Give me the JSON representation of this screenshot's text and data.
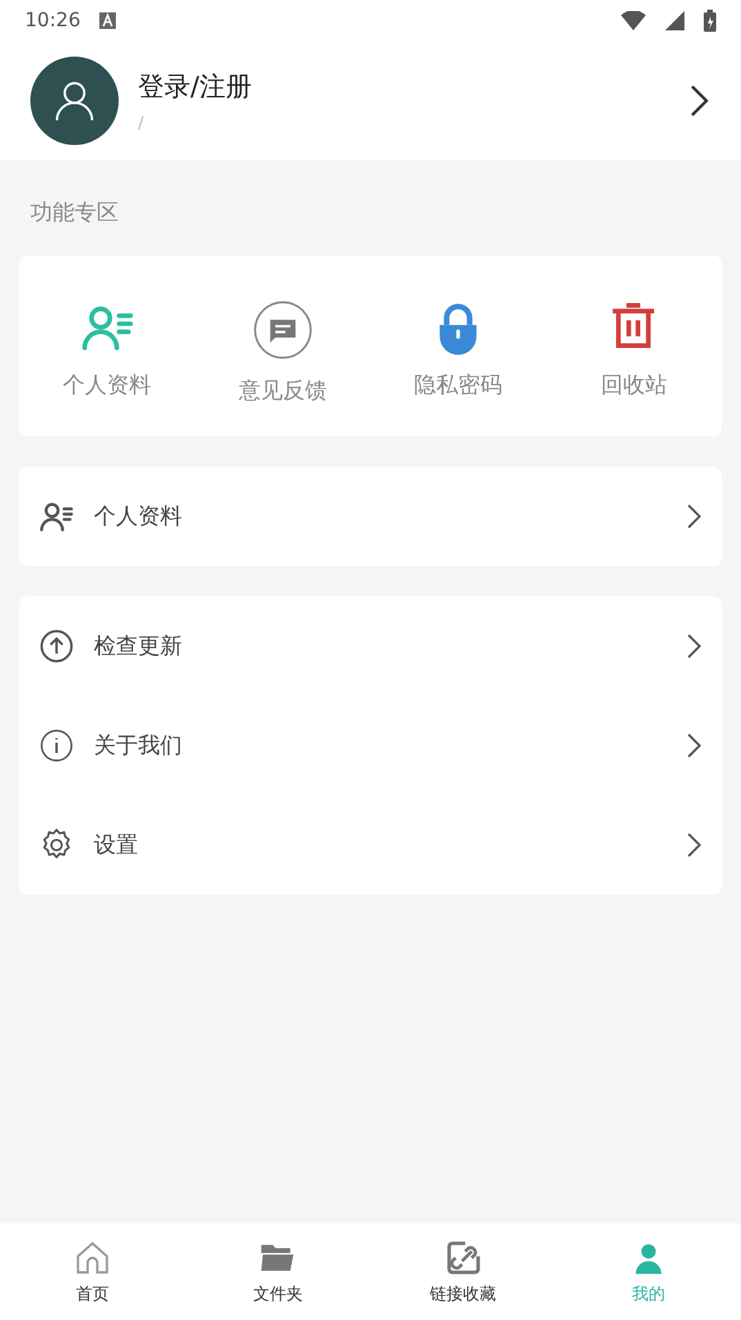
{
  "status_bar": {
    "time": "10:26"
  },
  "profile": {
    "name": "登录/注册",
    "subtitle": "/"
  },
  "section_title": "功能专区",
  "features": [
    {
      "kind": "profile",
      "label": "个人资料"
    },
    {
      "kind": "feedback",
      "label": "意见反馈"
    },
    {
      "kind": "lock",
      "label": "隐私密码"
    },
    {
      "kind": "trash",
      "label": "回收站"
    }
  ],
  "menu_groups": [
    [
      {
        "kind": "profile",
        "label": "个人资料"
      }
    ],
    [
      {
        "kind": "update",
        "label": "检查更新"
      },
      {
        "kind": "info",
        "label": "关于我们"
      },
      {
        "kind": "settings",
        "label": "设置"
      }
    ]
  ],
  "nav": [
    {
      "kind": "home",
      "label": "首页",
      "selected": false
    },
    {
      "kind": "folder",
      "label": "文件夹",
      "selected": false
    },
    {
      "kind": "link",
      "label": "链接收藏",
      "selected": false
    },
    {
      "kind": "me",
      "label": "我的",
      "selected": true
    }
  ]
}
